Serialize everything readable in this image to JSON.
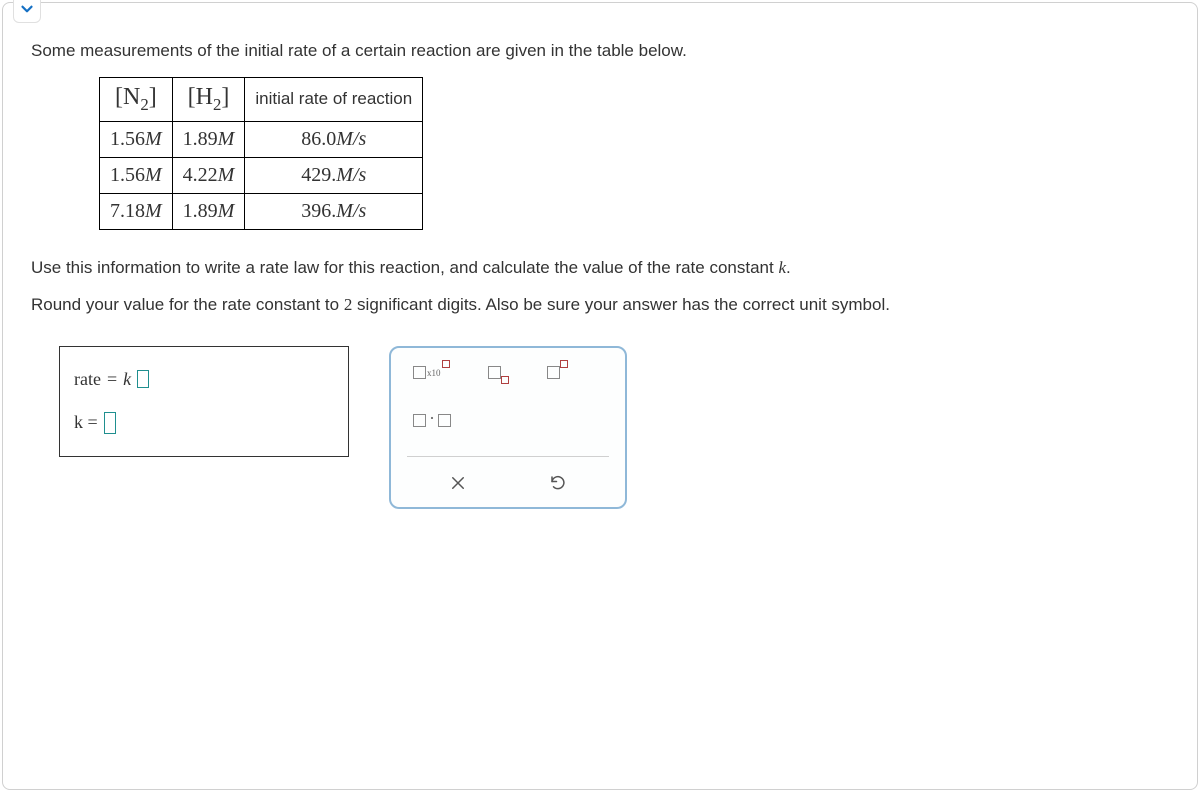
{
  "intro": "Some measurements of the initial rate of a certain reaction are given in the table below.",
  "table": {
    "headers": {
      "n2_species": "N",
      "n2_sub": "2",
      "h2_species": "H",
      "h2_sub": "2",
      "rate_header": "initial rate of reaction"
    },
    "rows": [
      {
        "n2": "1.56",
        "n2_unit": "M",
        "h2": "1.89",
        "h2_unit": "M",
        "rate": "86.0",
        "rate_unit": "M/s"
      },
      {
        "n2": "1.56",
        "n2_unit": "M",
        "h2": "4.22",
        "h2_unit": "M",
        "rate": "429.",
        "rate_unit": "M/s"
      },
      {
        "n2": "7.18",
        "n2_unit": "M",
        "h2": "1.89",
        "h2_unit": "M",
        "rate": "396.",
        "rate_unit": "M/s"
      }
    ]
  },
  "after1": "Use this information to write a rate law for this reaction, and calculate the value of the rate constant ",
  "after1_var": "k",
  "after1_end": ".",
  "after2_a": "Round your value for the rate constant to ",
  "after2_num": "2",
  "after2_b": " significant digits. Also be sure your answer has the correct unit symbol.",
  "answer": {
    "rate_label": "rate",
    "equals": " = ",
    "k_var": "k",
    "k_label": "k ="
  },
  "tools": {
    "x10": "x10"
  }
}
